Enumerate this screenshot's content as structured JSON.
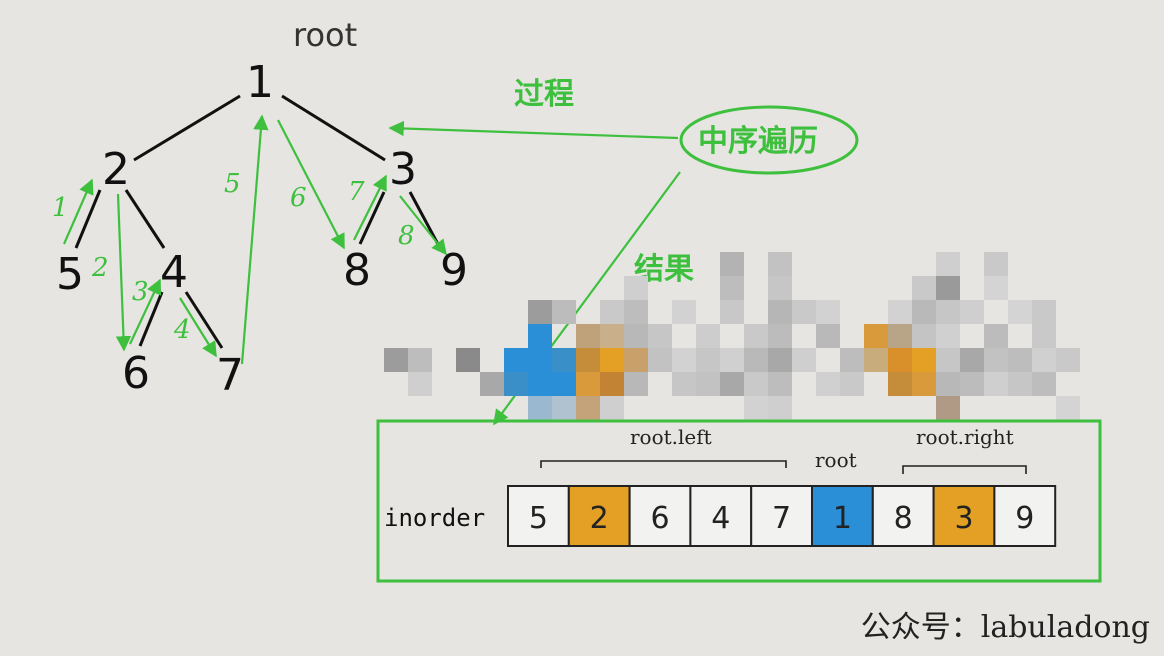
{
  "tree": {
    "root_label": "root",
    "nodes": [
      {
        "id": "1",
        "label": "1"
      },
      {
        "id": "2",
        "label": "2"
      },
      {
        "id": "3",
        "label": "3"
      },
      {
        "id": "5",
        "label": "5"
      },
      {
        "id": "4",
        "label": "4"
      },
      {
        "id": "6",
        "label": "6"
      },
      {
        "id": "7",
        "label": "7"
      },
      {
        "id": "8",
        "label": "8"
      },
      {
        "id": "9",
        "label": "9"
      }
    ],
    "steps": [
      "1",
      "2",
      "3",
      "4",
      "5",
      "6",
      "7",
      "8"
    ]
  },
  "annotations": {
    "process": "过程",
    "inorder_traversal": "中序遍历",
    "result": "结果"
  },
  "inorder": {
    "label": "inorder",
    "left_label": "root.left",
    "root_label": "root",
    "right_label": "root.right",
    "cells": [
      "5",
      "2",
      "6",
      "4",
      "7",
      "1",
      "8",
      "3",
      "9"
    ],
    "cell_colors": [
      "#f2f2f0",
      "#e3a025",
      "#f2f2f0",
      "#f2f2f0",
      "#f2f2f0",
      "#2a8fd6",
      "#f2f2f0",
      "#e3a025",
      "#f2f2f0"
    ]
  },
  "colors": {
    "green": "#3ec03e",
    "orange": "#e3a025",
    "blue": "#2a8fd6"
  },
  "watermark": {
    "prefix": "公众号",
    "sep": "：",
    "name": "labuladong"
  }
}
